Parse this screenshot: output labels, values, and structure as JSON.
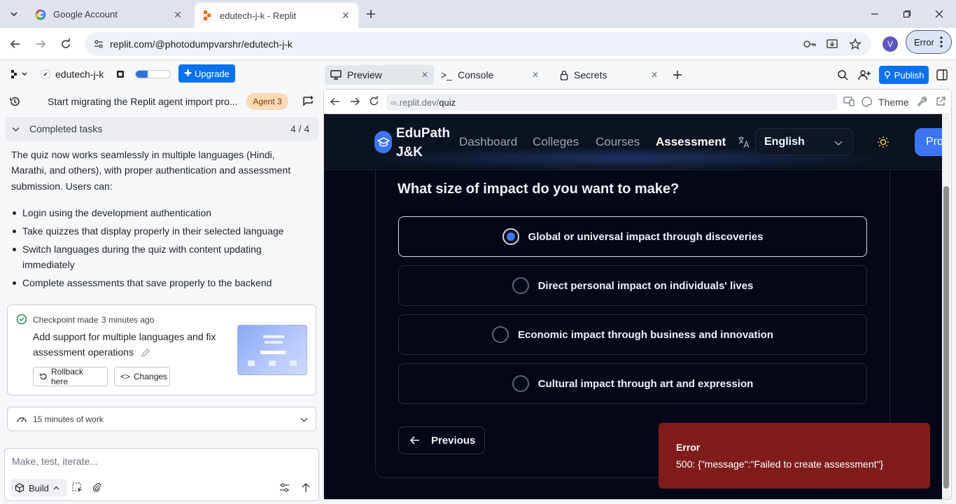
{
  "browser": {
    "tabs": [
      {
        "title": "Google Account",
        "icon": "google-icon",
        "active": false
      },
      {
        "title": "edutech-j-k - Replit",
        "icon": "replit-icon",
        "active": true
      }
    ],
    "url": "replit.com/@photodumpvarshr/edutech-j-k",
    "profile_initial": "V",
    "error_label": "Error"
  },
  "replit": {
    "project_name": "edutech-j-k",
    "upgrade_label": "Upgrade",
    "usage_progress": 0.35,
    "thread_title": "Start migrating the Replit agent import pro...",
    "agent_badge": "Agent 3",
    "completed_label": "Completed tasks",
    "completed_count": "4 / 4",
    "summary_line1": "The quiz now works seamlessly in multiple languages (Hindi,",
    "summary_line2": "Marathi, and others), with proper authentication and assessment",
    "summary_line3": "submission. Users can:",
    "bullets": [
      "Login using the development authentication",
      "Take quizzes that display properly in their selected language",
      "Switch languages during the quiz with content updating",
      "immediately",
      "Complete assessments that save properly to the backend"
    ],
    "checkpoint": {
      "made_text": "Checkpoint made",
      "time": "3 minutes ago",
      "desc_line1": "Add support for multiple languages and fix",
      "desc_line2": "assessment operations",
      "rollback_label": "Rollback here",
      "changes_label": "Changes"
    },
    "work_label": "15 minutes of work",
    "composer_placeholder": "Make, test, iterate...",
    "build_label": "Build",
    "right_tabs": {
      "preview": "Preview",
      "console": "Console",
      "secrets": "Secrets"
    },
    "publish_label": "Publish",
    "preview_url_prefix": ".replit.dev/",
    "preview_url_path": "quiz",
    "theme_label": "Theme"
  },
  "app": {
    "brand_line1": "EduPath",
    "brand_line2": "J&K",
    "nav": [
      "Dashboard",
      "Colleges",
      "Courses",
      "Assessment"
    ],
    "active_nav": "Assessment",
    "language": "English",
    "pro_label": "Pro",
    "question": "What size of impact do you want to make?",
    "options": [
      "Global or universal impact through discoveries",
      "Direct personal impact on individuals' lives",
      "Economic impact through business and innovation",
      "Cultural impact through art and expression"
    ],
    "selected_option": 0,
    "previous_label": "Previous",
    "toast_title": "Error",
    "toast_message": "500: {\"message\":\"Failed to create assessment\"}"
  },
  "colors": {
    "replit_blue": "#0a72ef",
    "app_bg": "#040816",
    "app_accent": "#3b76f0",
    "toast_bg": "#7f1d1d",
    "agent_badge_bg": "#fbd9b5"
  }
}
